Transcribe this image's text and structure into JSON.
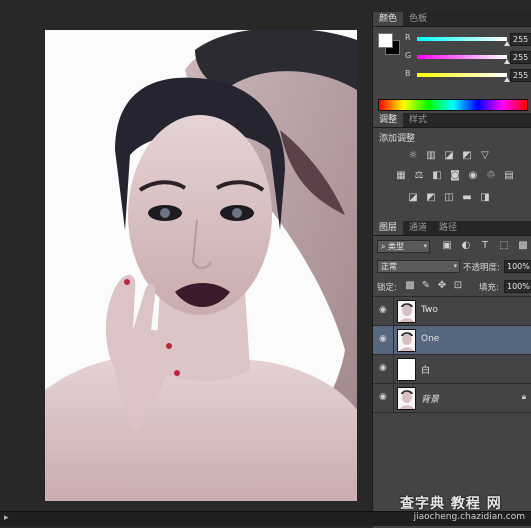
{
  "color_panel": {
    "tabs": [
      "颜色",
      "色板"
    ],
    "sliders": [
      {
        "label": "R",
        "value": "255",
        "gradient": "linear-gradient(to right,#00ffff,#ffffff)",
        "position": 1.0
      },
      {
        "label": "G",
        "value": "255",
        "gradient": "linear-gradient(to right,#ff00ff,#ffffff)",
        "position": 1.0
      },
      {
        "label": "B",
        "value": "255",
        "gradient": "linear-gradient(to right,#ffff00,#ffffff)",
        "position": 1.0
      }
    ]
  },
  "adjustments_panel": {
    "tabs": [
      "调整",
      "样式"
    ],
    "title": "添加调整"
  },
  "layers_panel": {
    "tabs": [
      "图层",
      "通道",
      "路径"
    ],
    "filter_type": "类型",
    "blend_mode": "正常",
    "opacity_label": "不透明度:",
    "opacity_value": "100%",
    "lock_label": "锁定:",
    "fill_label": "填充:",
    "fill_value": "100%",
    "layers": [
      {
        "name": "Two",
        "selected": false,
        "italic": false,
        "locked": false,
        "thumb": "photo"
      },
      {
        "name": "One",
        "selected": true,
        "italic": false,
        "locked": false,
        "thumb": "photo"
      },
      {
        "name": "白",
        "selected": false,
        "italic": false,
        "locked": false,
        "thumb": "white"
      },
      {
        "name": "背景",
        "selected": false,
        "italic": true,
        "locked": true,
        "thumb": "photo"
      }
    ]
  },
  "watermark": {
    "brand": "查字典 教程 网",
    "url": "jiaocheng.chazidian.com"
  }
}
